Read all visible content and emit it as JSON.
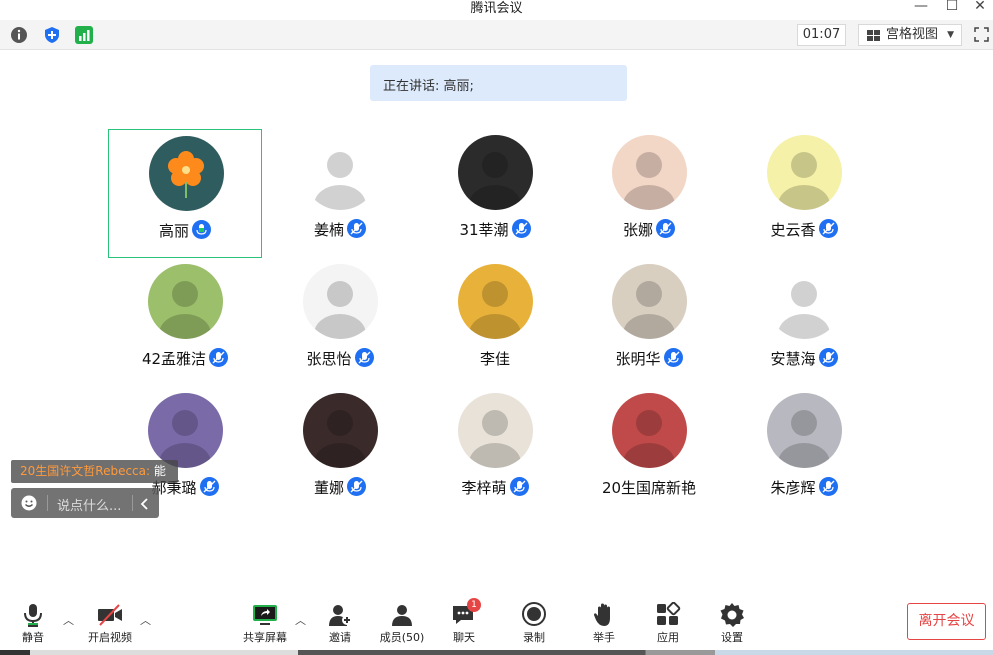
{
  "window": {
    "title": "腾讯会议",
    "minimize": "—",
    "maximize": "☐",
    "close": "✕"
  },
  "toolbar": {
    "timer": "01:07",
    "view_label": "宫格视图",
    "view_caret": "▼"
  },
  "speaking": {
    "label": "正在讲话: 高丽;"
  },
  "participants": [
    {
      "name": "高丽",
      "active": true,
      "mic": "on"
    },
    {
      "name": "姜楠",
      "mic": "muted"
    },
    {
      "name": "31莘潮",
      "mic": "muted"
    },
    {
      "name": "张娜",
      "mic": "muted"
    },
    {
      "name": "史云香",
      "mic": "muted"
    },
    {
      "name": "42孟雅洁",
      "mic": "muted"
    },
    {
      "name": "张思怡",
      "mic": "muted"
    },
    {
      "name": "李佳",
      "mic": "none"
    },
    {
      "name": "张明华",
      "mic": "muted"
    },
    {
      "name": "安慧海",
      "mic": "muted"
    },
    {
      "name": "郝秉璐",
      "mic": "muted"
    },
    {
      "name": "董娜",
      "mic": "muted"
    },
    {
      "name": "李梓萌",
      "mic": "muted"
    },
    {
      "name": "20生国席新艳",
      "mic": "none"
    },
    {
      "name": "朱彦辉",
      "mic": "muted"
    }
  ],
  "chat": {
    "sender": "20生国许文哲Rebecca:",
    "message": " 能",
    "placeholder": "说点什么..."
  },
  "controls": {
    "mute": "静音",
    "video": "开启视频",
    "share": "共享屏幕",
    "invite": "邀请",
    "members": "成员(50)",
    "chat": "聊天",
    "chat_badge": "1",
    "record": "录制",
    "raise_hand": "举手",
    "apps": "应用",
    "settings": "设置",
    "leave": "离开会议"
  },
  "colors": {
    "accent": "#1f6ff2",
    "active_border": "#2bc37a",
    "leave": "#e54545",
    "speaking_bg": "#dceafc"
  }
}
